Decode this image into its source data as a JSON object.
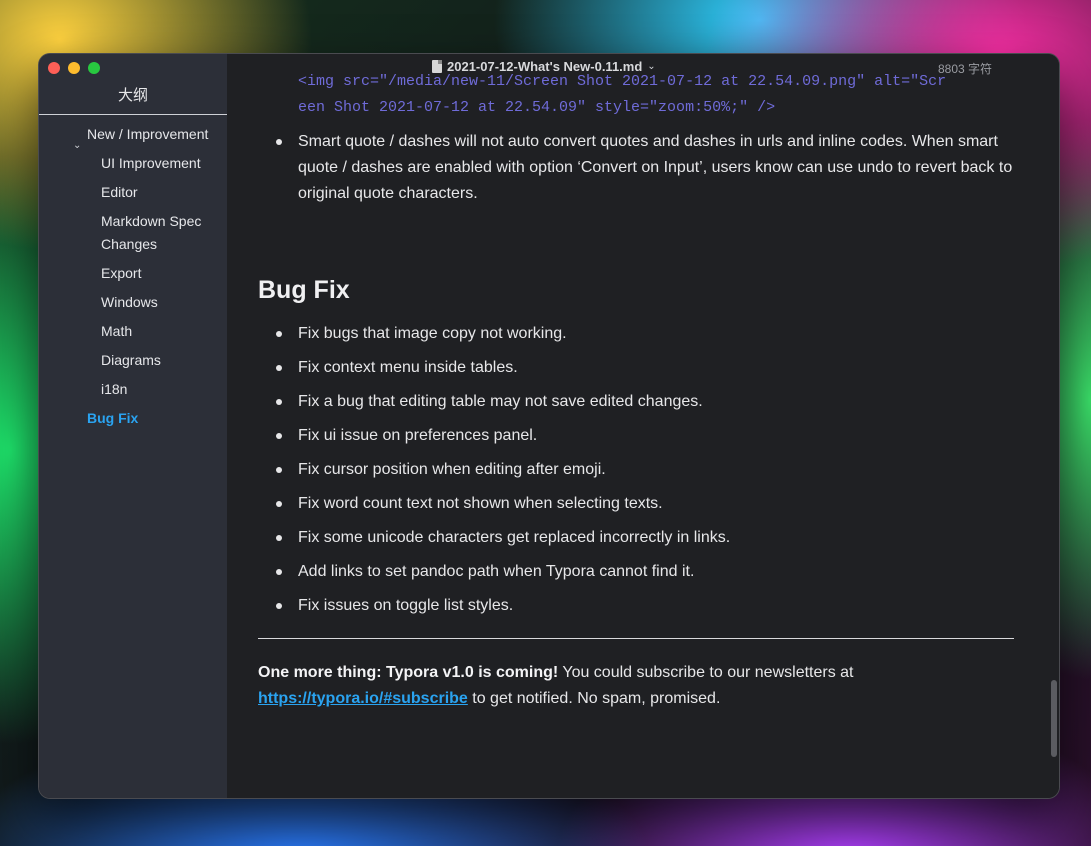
{
  "sidebar": {
    "title": "大纲",
    "items": [
      {
        "label": "New / Improvement"
      },
      {
        "label": "UI Improvement"
      },
      {
        "label": "Editor"
      },
      {
        "label": "Markdown Spec Changes"
      },
      {
        "label": "Export"
      },
      {
        "label": "Windows"
      },
      {
        "label": "Math"
      },
      {
        "label": "Diagrams"
      },
      {
        "label": "i18n"
      },
      {
        "label": "Bug Fix"
      }
    ]
  },
  "titlebar": {
    "filename": "2021-07-12-What's New-0.11.md",
    "word_count": "8803 字符"
  },
  "content": {
    "code_line_1": "<img src=\"/media/new-11/Screen Shot 2021-07-12 at 22.54.09.png\" alt=\"Scr",
    "code_line_2": "een Shot 2021-07-12 at 22.54.09\" style=\"zoom:50%;\" />",
    "smart_quote": "Smart quote / dashes will not auto convert quotes and dashes in urls and inline codes. When smart quote / dashes are enabled with option ‘Convert on Input’, users know can use undo to revert back to original quote characters.",
    "bug_heading": "Bug Fix",
    "bug_items": [
      "Fix bugs that image copy not working.",
      "Fix context menu inside tables.",
      "Fix a bug that editing table may not save edited changes.",
      "Fix ui issue on preferences panel.",
      "Fix cursor position when editing after emoji.",
      "Fix word count text not shown when selecting texts.",
      "Fix some unicode characters get replaced incorrectly in links.",
      "Add links to set pandoc path when Typora cannot find it.",
      "Fix issues on toggle list styles."
    ],
    "one_more_bold": "One more thing: Typora v1.0 is coming!",
    "one_more_text": " You could subscribe to our newsletters at ",
    "subscribe_link": "https://typora.io/#subscribe",
    "one_more_tail": " to get notified. No spam, promised."
  },
  "colors": {
    "accent": "#2aa3f0",
    "sidebar_bg": "#2c2f38",
    "editor_bg": "#1f2023",
    "code_color": "#6f6bd8"
  },
  "icons": [
    "close-button",
    "minimize-button",
    "maximize-button",
    "file-icon",
    "chevron-down-icon"
  ]
}
